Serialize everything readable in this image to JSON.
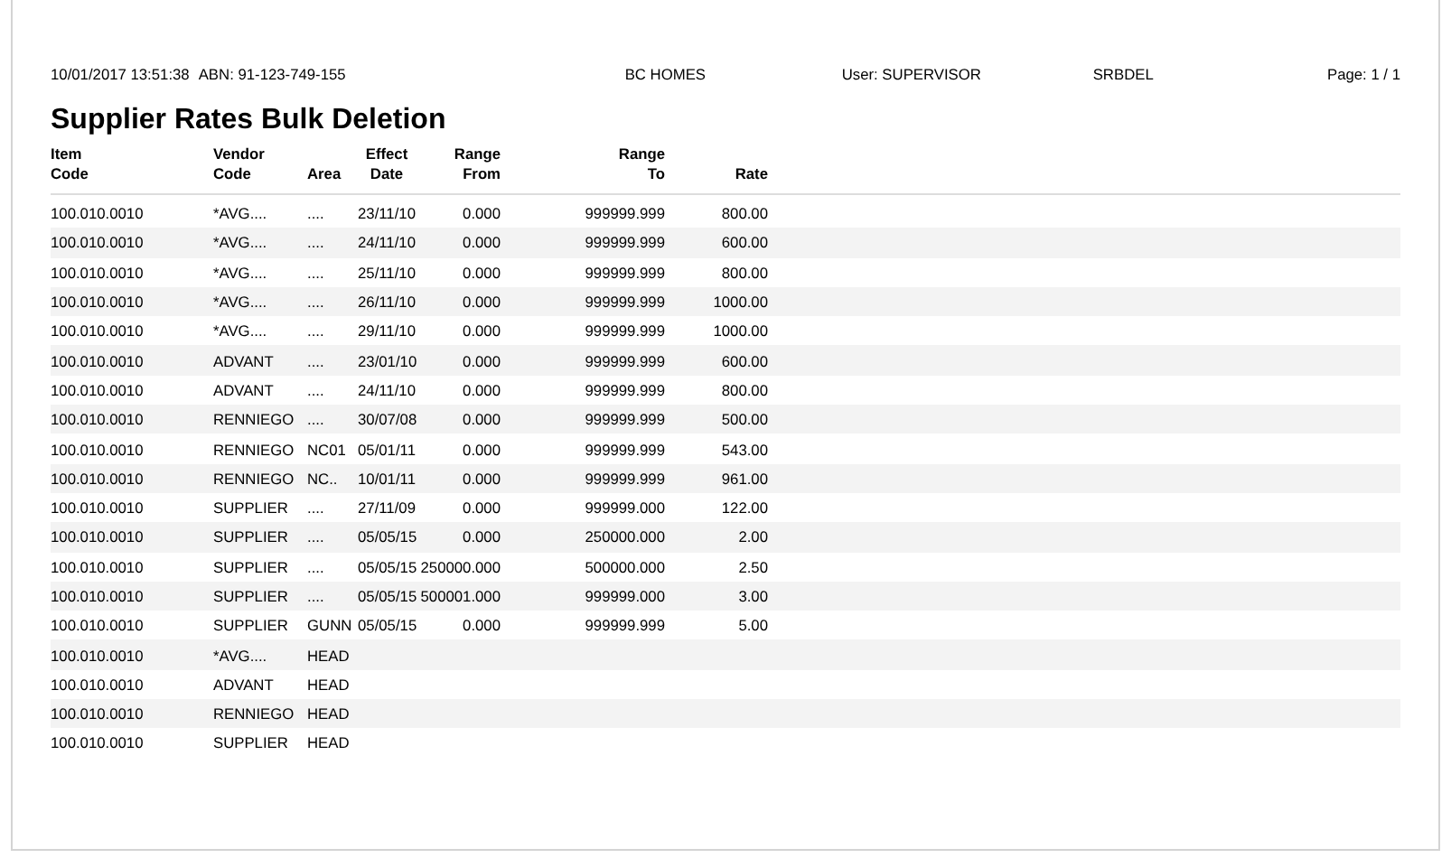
{
  "header": {
    "timestamp": "10/01/2017 13:51:38",
    "abn": "ABN: 91-123-749-155",
    "company": "BC HOMES",
    "user": "User: SUPERVISOR",
    "report_code": "SRBDEL",
    "page": "Page: 1 / 1"
  },
  "title": "Supplier Rates Bulk Deletion",
  "columns": [
    {
      "line1": "Item",
      "line2": "Code"
    },
    {
      "line1": "Vendor",
      "line2": "Code"
    },
    {
      "line2": "Area"
    },
    {
      "line1": "Effect",
      "line2": "Date"
    },
    {
      "line1": "Range",
      "line2": "From"
    },
    {
      "line1": "Range",
      "line2": "To"
    },
    {
      "line2": "Rate"
    }
  ],
  "rows": [
    [
      "100.010.0010",
      "*AVG....",
      "....",
      "23/11/10",
      "0.000",
      "999999.999",
      "800.00"
    ],
    [
      "100.010.0010",
      "*AVG....",
      "....",
      "24/11/10",
      "0.000",
      "999999.999",
      "600.00"
    ],
    [
      "100.010.0010",
      "*AVG....",
      "....",
      "25/11/10",
      "0.000",
      "999999.999",
      "800.00"
    ],
    [
      "100.010.0010",
      "*AVG....",
      "....",
      "26/11/10",
      "0.000",
      "999999.999",
      "1000.00"
    ],
    [
      "100.010.0010",
      "*AVG....",
      "....",
      "29/11/10",
      "0.000",
      "999999.999",
      "1000.00"
    ],
    [
      "100.010.0010",
      "ADVANT",
      "....",
      "23/01/10",
      "0.000",
      "999999.999",
      "600.00"
    ],
    [
      "100.010.0010",
      "ADVANT",
      "....",
      "24/11/10",
      "0.000",
      "999999.999",
      "800.00"
    ],
    [
      "100.010.0010",
      "RENNIEGO",
      "....",
      "30/07/08",
      "0.000",
      "999999.999",
      "500.00"
    ],
    [
      "100.010.0010",
      "RENNIEGO",
      "NC01",
      "05/01/11",
      "0.000",
      "999999.999",
      "543.00"
    ],
    [
      "100.010.0010",
      "RENNIEGO",
      "NC..",
      "10/01/11",
      "0.000",
      "999999.999",
      "961.00"
    ],
    [
      "100.010.0010",
      "SUPPLIER",
      "....",
      "27/11/09",
      "0.000",
      "999999.000",
      "122.00"
    ],
    [
      "100.010.0010",
      "SUPPLIER",
      "....",
      "05/05/15",
      "0.000",
      "250000.000",
      "2.00"
    ],
    [
      "100.010.0010",
      "SUPPLIER",
      "....",
      "05/05/15",
      "250000.000",
      "500000.000",
      "2.50"
    ],
    [
      "100.010.0010",
      "SUPPLIER",
      "....",
      "05/05/15",
      "500001.000",
      "999999.000",
      "3.00"
    ],
    [
      "100.010.0010",
      "SUPPLIER",
      "GUNN",
      "05/05/15",
      "0.000",
      "999999.999",
      "5.00"
    ],
    [
      "100.010.0010",
      "*AVG....",
      "HEAD"
    ],
    [
      "100.010.0010",
      "ADVANT",
      "HEAD"
    ],
    [
      "100.010.0010",
      "RENNIEGO",
      "HEAD"
    ],
    [
      "100.010.0010",
      "SUPPLIER",
      "HEAD"
    ]
  ]
}
